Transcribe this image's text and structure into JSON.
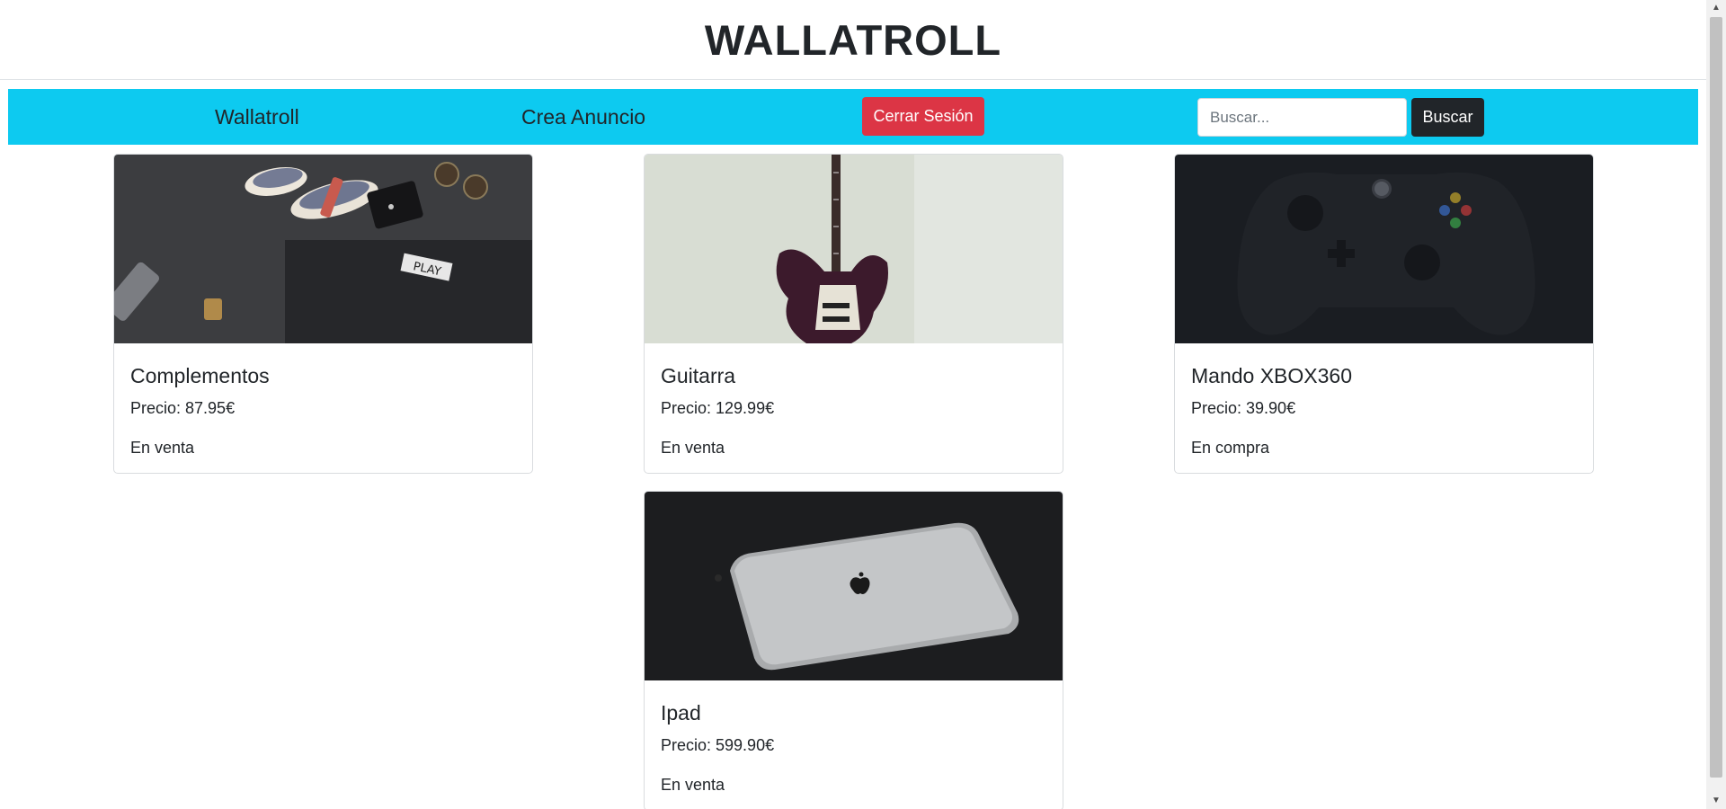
{
  "header": {
    "title": "WALLATROLL"
  },
  "nav": {
    "home_label": "Wallatroll",
    "create_label": "Crea Anuncio",
    "logout_label": "Cerrar Sesión",
    "search_placeholder": "Buscar...",
    "search_value": "",
    "search_button": "Buscar"
  },
  "colors": {
    "navbar": "#0dcaf0",
    "logout_button": "#dc3545",
    "search_button": "#212529"
  },
  "products": [
    {
      "name": "Complementos",
      "price": "Precio: 87.95€",
      "status": "En venta",
      "image": "accessories-photo"
    },
    {
      "name": "Guitarra",
      "price": "Precio: 129.99€",
      "status": "En venta",
      "image": "guitar-photo"
    },
    {
      "name": "Mando XBOX360",
      "price": "Precio: 39.90€",
      "status": "En compra",
      "image": "controller-photo"
    },
    {
      "name": "Ipad",
      "price": "Precio: 599.90€",
      "status": "En venta",
      "image": "tablet-photo"
    }
  ]
}
